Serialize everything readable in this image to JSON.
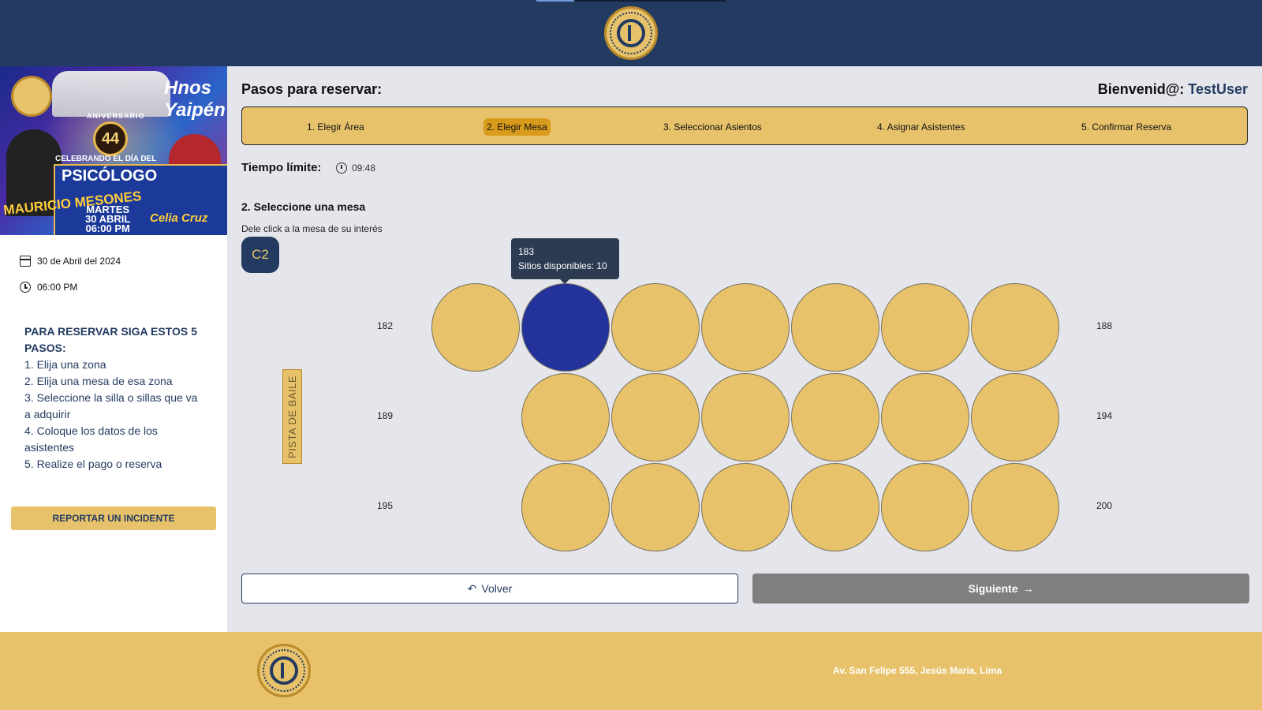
{
  "header": {
    "logo_icon": "cpp-logo-icon"
  },
  "sidebar": {
    "banner": {
      "brand": "Hnos Yaipén",
      "aniversario": "ANIVERSARIO",
      "number": "44",
      "subtitle": "CELEBRANDO EL DÍA DEL",
      "title": "PSICÓLOGO",
      "artist_left": "MAURICIO MESONES",
      "day": "MARTES",
      "date": "30 ABRIL",
      "time": "06:00 PM",
      "artist_right": "Celia Cruz"
    },
    "event_date": "30 de Abril del 2024",
    "event_time": "06:00 PM",
    "steps_heading": "PARA RESERVAR SIGA ESTOS 5 PASOS:",
    "steps": [
      "1. Elija una zona",
      "2. Elija una mesa de esa zona",
      "3. Seleccione la silla o sillas que va a adquirir",
      "4. Coloque los datos de los asistentes",
      "5. Realize el pago o reserva"
    ],
    "report_button": "REPORTAR UN INCIDENTE"
  },
  "main": {
    "title": "Pasos para reservar:",
    "welcome_prefix": "Bienvenid@: ",
    "username": "TestUser",
    "stepper": [
      {
        "label": "1. Elegir Área",
        "active": false
      },
      {
        "label": "2. Elegir Mesa",
        "active": true
      },
      {
        "label": "3. Seleccionar Asientos",
        "active": false
      },
      {
        "label": "4. Asignar Asistentes",
        "active": false
      },
      {
        "label": "5. Confirmar Reserva",
        "active": false
      }
    ],
    "time_limit_label": "Tiempo límite:",
    "time_remaining": "09:48",
    "section_title": "2. Seleccione una mesa",
    "section_help": "Dele click a la mesa de su interés",
    "zone": "C2",
    "dance_floor": "PISTA DE BAILE",
    "rows": [
      {
        "start": "182",
        "end": "188"
      },
      {
        "start": "189",
        "end": "194"
      },
      {
        "start": "195",
        "end": "200"
      }
    ],
    "selected_table": "183",
    "tooltip": {
      "table": "183",
      "available": "Sitios disponibles: 10"
    },
    "back_button": "Volver",
    "next_button": "Siguiente"
  },
  "footer": {
    "address": "Av. San Felipe 555, Jesús María, Lima"
  },
  "colors": {
    "navy": "#243b61",
    "gold": "#e7c26b",
    "selected": "#24339c",
    "active_step": "#d99b1c"
  }
}
